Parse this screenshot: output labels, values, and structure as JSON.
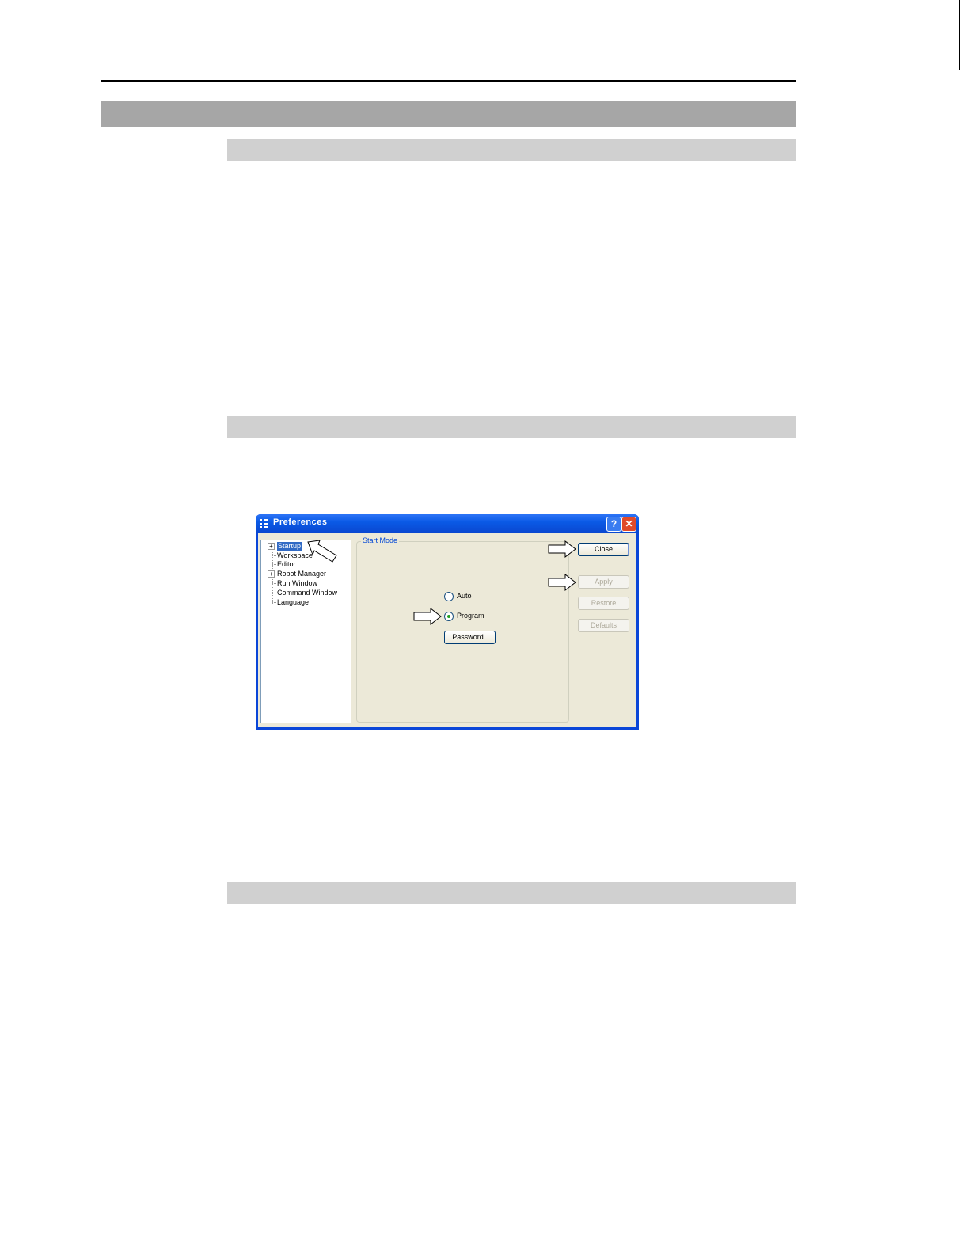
{
  "dialog": {
    "title": "Preferences",
    "help_symbol": "?",
    "close_symbol": "✕",
    "tree": [
      {
        "label": "Startup",
        "expandable": true,
        "selected": true
      },
      {
        "label": "Workspace",
        "expandable": false,
        "selected": false
      },
      {
        "label": "Editor",
        "expandable": false,
        "selected": false
      },
      {
        "label": "Robot Manager",
        "expandable": true,
        "selected": false
      },
      {
        "label": "Run Window",
        "expandable": false,
        "selected": false
      },
      {
        "label": "Command Window",
        "expandable": false,
        "selected": false
      },
      {
        "label": "Language",
        "expandable": false,
        "selected": false
      }
    ],
    "group_label": "Start Mode",
    "radio_auto": "Auto",
    "radio_program": "Program",
    "selected_mode": "Program",
    "password_button": "Password..",
    "buttons": {
      "close": "Close",
      "apply": "Apply",
      "restore": "Restore",
      "defaults": "Defaults"
    }
  }
}
